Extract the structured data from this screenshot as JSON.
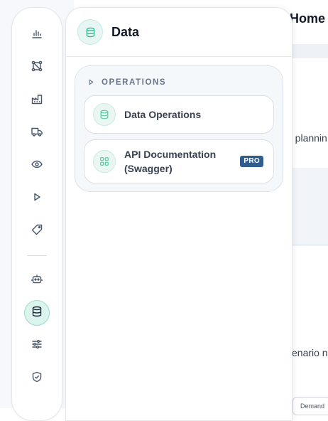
{
  "background": {
    "header_title": "Home",
    "snippet_1": "o plannin",
    "snippet_2": "cenario n",
    "tab_label": "Demand"
  },
  "rail": {
    "items": [
      {
        "icon": "bar-chart-icon"
      },
      {
        "icon": "network-icon"
      },
      {
        "icon": "factory-icon"
      },
      {
        "icon": "truck-icon"
      },
      {
        "icon": "eye-icon"
      },
      {
        "icon": "play-icon"
      },
      {
        "icon": "tag-icon"
      },
      {
        "icon": "robot-icon"
      },
      {
        "icon": "database-icon",
        "active": true
      },
      {
        "icon": "sliders-icon"
      },
      {
        "icon": "shield-check-icon"
      }
    ]
  },
  "panel": {
    "title": "Data",
    "icon": "database-icon",
    "group": {
      "label": "OPERATIONS",
      "items": [
        {
          "label": "Data Operations",
          "icon": "database-icon"
        },
        {
          "label_line1": "API Documentation",
          "label_line2": "(Swagger)",
          "icon": "grid-icon",
          "badge": "PRO"
        }
      ]
    }
  },
  "colors": {
    "accent": "#34b894",
    "accent_bg": "#e7f6f2",
    "badge_bg": "#2f5d8f"
  }
}
